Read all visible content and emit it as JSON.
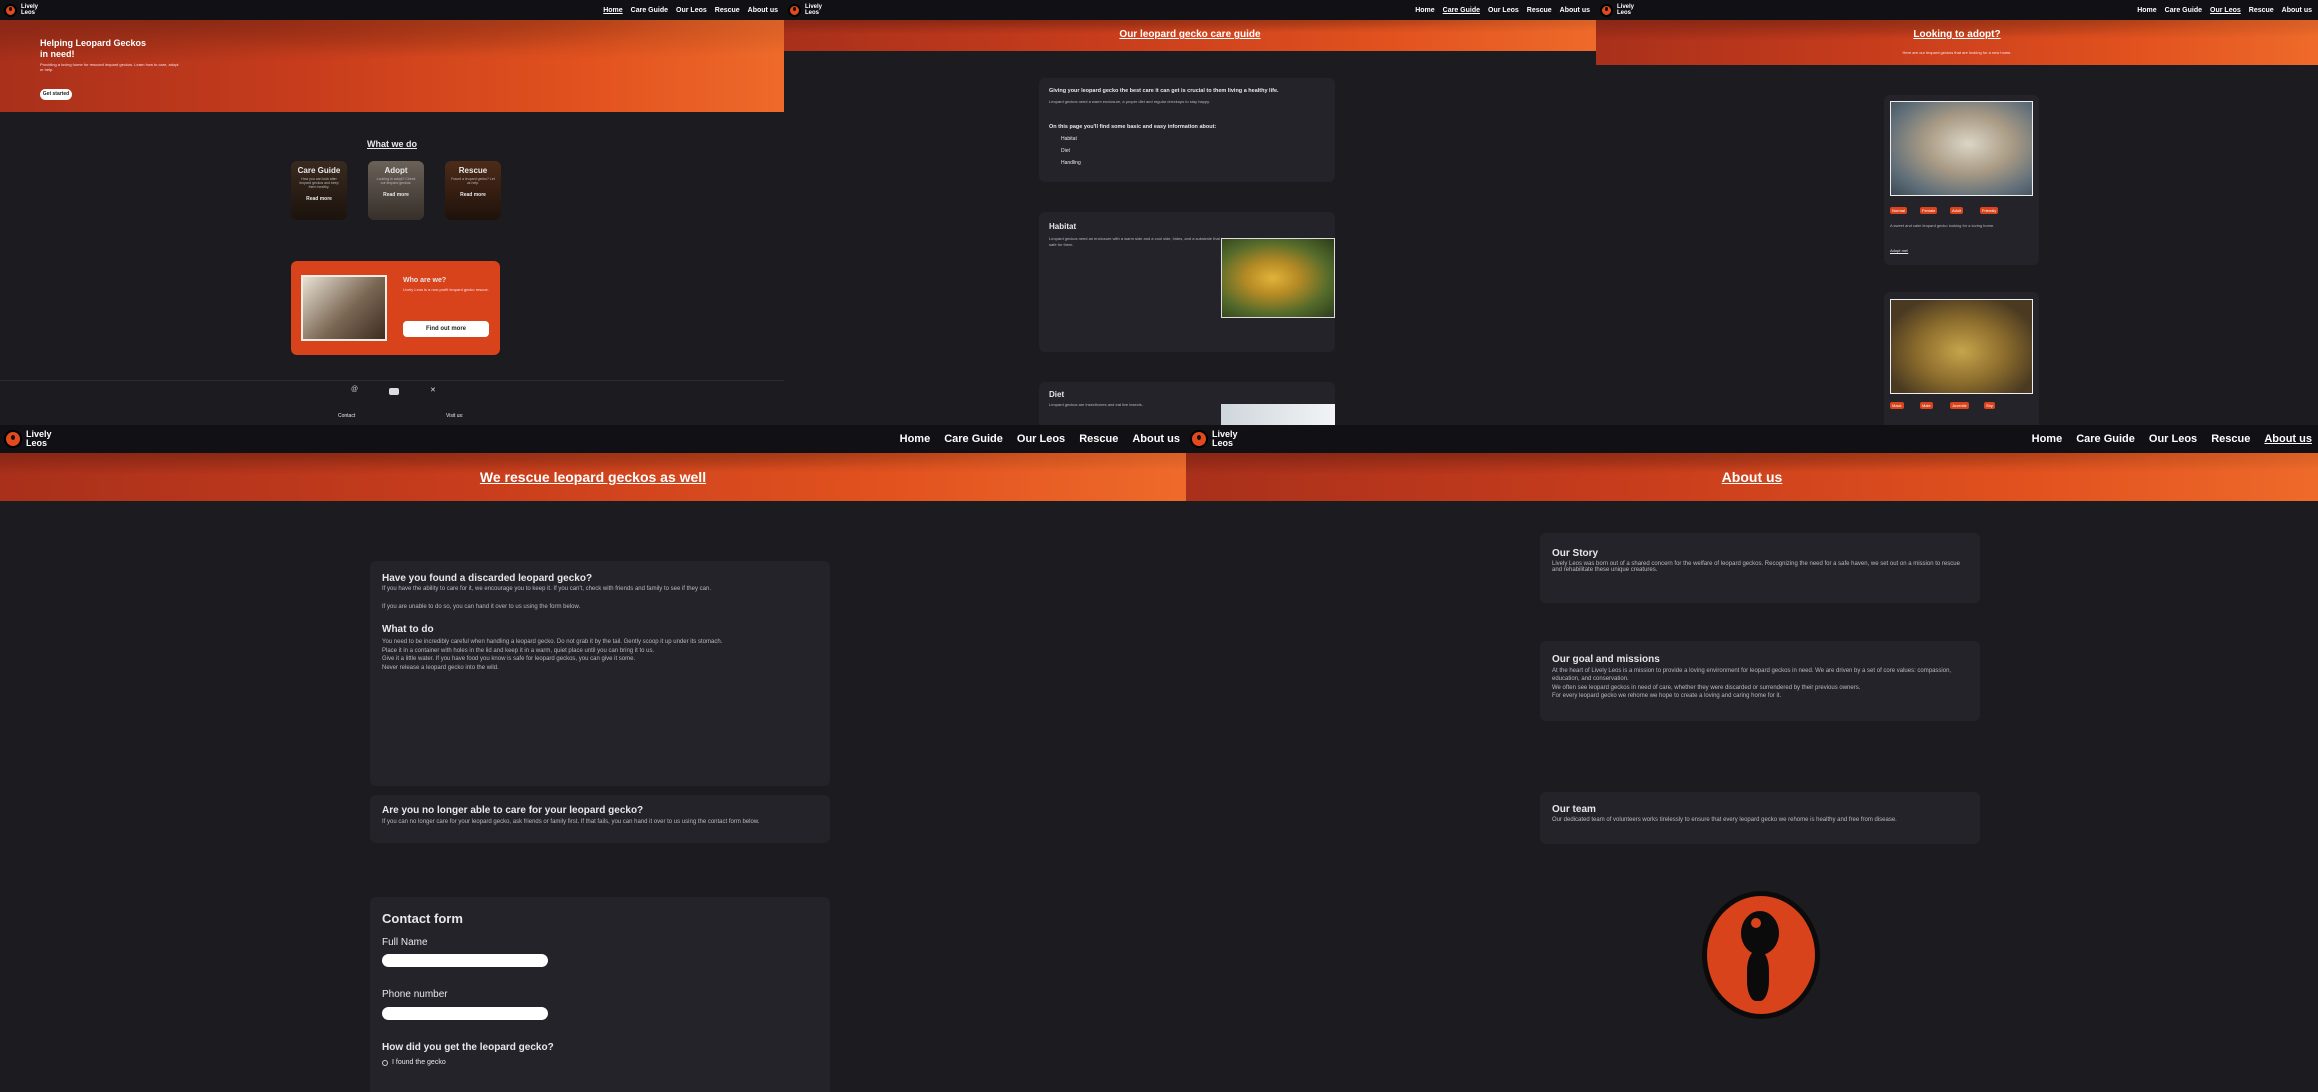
{
  "brand": {
    "name_line1": "Lively",
    "name_line2": "Leos",
    "accent": "#e24a1e",
    "bg": "#1c1b20",
    "card_bg": "#24232a"
  },
  "nav": {
    "home": "Home",
    "care_guide": "Care Guide",
    "our_leos": "Our Leos",
    "rescue": "Rescue",
    "about_us": "About us"
  },
  "home": {
    "hero_title_line1": "Helping Leopard Geckos",
    "hero_title_line2": "in need!",
    "hero_text": "Providing a loving home for rescued leopard geckos. Learn how to care, adopt or help.",
    "hero_button": "Get started",
    "section_title": "What we do",
    "tiles": [
      {
        "title": "Care Guide",
        "text": "How you can look after leopard geckos and keep them healthy.",
        "button": "Read more"
      },
      {
        "title": "Adopt",
        "text": "Looking to adopt? Check our leopard geckos.",
        "button": "Read more"
      },
      {
        "title": "Rescue",
        "text": "Found a leopard gecko? Let us help.",
        "button": "Read more"
      }
    ],
    "who_title": "Who are we?",
    "who_text": "Lively Leos is a non-profit leopard gecko rescue.",
    "who_button": "Find out more",
    "footer_contact": "Contact",
    "footer_visit": "Visit us:"
  },
  "care": {
    "banner_title": "Our leopard gecko care guide",
    "intro_heading": "Giving your leopard gecko the best care it can get is crucial to them living a healthy life.",
    "intro_text": "Leopard geckos need a warm enclosure, a proper diet and regular checkups to stay happy.",
    "topics_heading": "On this page you'll find some basic and easy information about:",
    "topics": [
      "Habitat",
      "Diet",
      "Handling"
    ],
    "habitat_title": "Habitat",
    "habitat_text": "Leopard geckos need an enclosure with a warm side and a cool side, hides, and a substrate that is safe for them.",
    "diet_title": "Diet",
    "diet_text": "Leopard geckos are insectivores and eat live insects."
  },
  "leos": {
    "banner_title": "Looking to adopt?",
    "banner_sub": "Here are our leopard geckos that are looking for a new home.",
    "gecko1_tags": [
      "Normal",
      "Female",
      "Adult",
      "Friendly"
    ],
    "gecko1_text": "A sweet and calm leopard gecko looking for a loving home.",
    "gecko1_link": "Adopt me!",
    "gecko2_tags": [
      "Mack",
      "Male",
      "Juvenile",
      "Shy"
    ]
  },
  "rescue": {
    "banner_title": "We rescue leopard geckos as well",
    "found_title": "Have you found a discarded leopard gecko?",
    "found_text1": "If you have the ability to care for it, we encourage you to keep it. If you can't, check with friends and family to see if they can.",
    "found_text2": "If you are unable to do so, you can hand it over to us using the form below.",
    "todo_title": "What to do",
    "todo_text1": "You need to be incredibly careful when handling a leopard gecko. Do not grab it by the tail. Gently scoop it up under its stomach.",
    "todo_text2": "Place it in a container with holes in the lid and keep it in a warm, quiet place until you can bring it to us.",
    "todo_text3": "Give it a little water. If you have food you know is safe for leopard geckos, you can give it some.",
    "todo_text4": "Never release a leopard gecko into the wild.",
    "unable_title": "Are you no longer able to care for your leopard gecko?",
    "unable_text": "If you can no longer care for your leopard gecko, ask friends or family first. If that fails, you can hand it over to us using the contact form below.",
    "contact_title": "Contact form",
    "field_full_name": "Full Name",
    "field_phone": "Phone number",
    "question": "How did you get the leopard gecko?",
    "option1": "I found the gecko"
  },
  "about": {
    "banner_title": "About us",
    "story_title": "Our Story",
    "story_text": "Lively Leos was born out of a shared concern for the welfare of leopard geckos. Recognizing the need for a safe haven, we set out on a mission to rescue and rehabilitate these unique creatures.",
    "mission_title": "Our goal and missions",
    "mission_text1": "At the heart of Lively Leos is a mission to provide a loving environment for leopard geckos in need. We are driven by a set of core values: compassion, education, and conservation.",
    "mission_text2": "We often see leopard geckos in need of care, whether they were discarded or surrendered by their previous owners.",
    "mission_text3": "For every leopard gecko we rehome we hope to create a loving and caring home for it.",
    "team_title": "Our team",
    "team_text": "Our dedicated team of volunteers works tirelessly to ensure that every leopard gecko we rehome is healthy and free from disease."
  }
}
